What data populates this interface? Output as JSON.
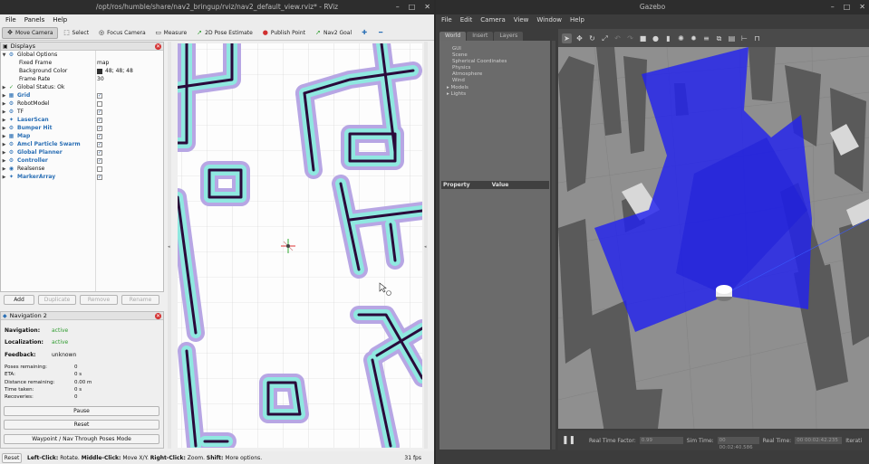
{
  "rviz": {
    "title": "/opt/ros/humble/share/nav2_bringup/rviz/nav2_default_view.rviz* - RViz",
    "menu": [
      "File",
      "Panels",
      "Help"
    ],
    "tools": [
      {
        "label": "Move Camera",
        "icon": "✥"
      },
      {
        "label": "Select",
        "icon": "⬚"
      },
      {
        "label": "Focus Camera",
        "icon": "◎"
      },
      {
        "label": "Measure",
        "icon": "▭"
      },
      {
        "label": "2D Pose Estimate",
        "icon": "➚"
      },
      {
        "label": "Publish Point",
        "icon": "●"
      },
      {
        "label": "Nav2 Goal",
        "icon": "➚"
      }
    ],
    "displays": {
      "title": "Displays",
      "global_options": "Global Options",
      "fixed_frame_label": "Fixed Frame",
      "fixed_frame_value": "map",
      "background_color_label": "Background Color",
      "background_color_value": "48; 48; 48",
      "frame_rate_label": "Frame Rate",
      "frame_rate_value": "30",
      "global_status": "Global Status: Ok",
      "items": [
        {
          "label": "Grid",
          "checked": true,
          "bold": true
        },
        {
          "label": "RobotModel",
          "checked": false,
          "bold": false
        },
        {
          "label": "TF",
          "checked": true,
          "bold": false
        },
        {
          "label": "LaserScan",
          "checked": true,
          "bold": true
        },
        {
          "label": "Bumper Hit",
          "checked": true,
          "bold": true
        },
        {
          "label": "Map",
          "checked": true,
          "bold": true
        },
        {
          "label": "Amcl Particle Swarm",
          "checked": true,
          "bold": true
        },
        {
          "label": "Global Planner",
          "checked": true,
          "bold": true
        },
        {
          "label": "Controller",
          "checked": true,
          "bold": true
        },
        {
          "label": "Realsense",
          "checked": false,
          "bold": false
        },
        {
          "label": "MarkerArray",
          "checked": true,
          "bold": true
        }
      ],
      "buttons": {
        "add": "Add",
        "duplicate": "Duplicate",
        "remove": "Remove",
        "rename": "Rename"
      }
    },
    "navigation": {
      "title": "Navigation 2",
      "navigation_label": "Navigation:",
      "navigation_value": "active",
      "localization_label": "Localization:",
      "localization_value": "active",
      "feedback_label": "Feedback:",
      "feedback_value": "unknown",
      "stats": [
        {
          "label": "Poses remaining:",
          "value": "0"
        },
        {
          "label": "ETA:",
          "value": "0 s"
        },
        {
          "label": "Distance remaining:",
          "value": "0.00 m"
        },
        {
          "label": "Time taken:",
          "value": "0 s"
        },
        {
          "label": "Recoveries:",
          "value": "0"
        }
      ],
      "pause": "Pause",
      "reset": "Reset",
      "waypoint_mode": "Waypoint / Nav Through Poses Mode"
    },
    "status": {
      "reset": "Reset",
      "hint_left_key": "Left-Click:",
      "hint_left": "Rotate.",
      "hint_middle_key": "Middle-Click:",
      "hint_middle": "Move X/Y.",
      "hint_right_key": "Right-Click:",
      "hint_right": "Zoom.",
      "hint_shift_key": "Shift:",
      "hint_shift": "More options.",
      "fps": "31 fps"
    }
  },
  "gazebo": {
    "title": "Gazebo",
    "menu": [
      "File",
      "Edit",
      "Camera",
      "View",
      "Window",
      "Help"
    ],
    "tabs": [
      "World",
      "Insert",
      "Layers"
    ],
    "world_items": [
      "GUI",
      "Scene",
      "Spherical Coordinates",
      "Physics",
      "Atmosphere",
      "Wind"
    ],
    "tree_items": [
      "Models",
      "Lights"
    ],
    "property_col": "Property",
    "value_col": "Value",
    "bottom": {
      "rtf_label": "Real Time Factor:",
      "rtf_value": "0.99",
      "sim_label": "Sim Time:",
      "sim_value": "00 00:02:40.586",
      "real_label": "Real Time:",
      "real_value": "00 00:02:42.235",
      "iter_label": "Iterati"
    }
  },
  "colors": {
    "map_occupied": "#2a0a3a",
    "inflation_cyan": "#8fe8e0",
    "inflation_lavender": "#b7a6e4",
    "laser_blue": "#2222ee"
  }
}
